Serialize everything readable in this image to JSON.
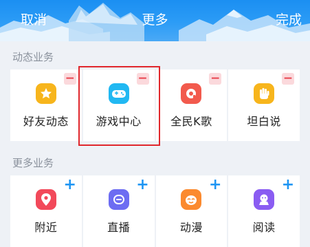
{
  "header": {
    "cancel_label": "取消",
    "title": "更多",
    "done_label": "完成"
  },
  "sections": [
    {
      "label": "动态业务",
      "items": [
        {
          "label": "好友动态",
          "icon": "star-icon",
          "color": "#f7b51c",
          "action": "−"
        },
        {
          "label": "游戏中心",
          "icon": "gamepad-icon",
          "color": "#21b8f2",
          "action": "−"
        },
        {
          "label": "全民K歌",
          "icon": "karaoke-icon",
          "color": "#f25a4d",
          "action": "−"
        },
        {
          "label": "坦白说",
          "icon": "hand-icon",
          "color": "#f7b51c",
          "action": "−"
        }
      ]
    },
    {
      "label": "更多业务",
      "items": [
        {
          "label": "附近",
          "icon": "location-pin-icon",
          "color": "#f2495a",
          "action": "+"
        },
        {
          "label": "直播",
          "icon": "live-icon",
          "color": "#6d6df2",
          "action": "+"
        },
        {
          "label": "动漫",
          "icon": "anime-icon",
          "color": "#fb8a2f",
          "action": "+"
        },
        {
          "label": "阅读",
          "icon": "reader-icon",
          "color": "#8a5cf2",
          "action": "+"
        }
      ]
    }
  ],
  "colors": {
    "header_blue": "#1b8ff2",
    "remove_red": "#e8414d",
    "add_blue": "#1d95f3",
    "highlight_red": "#e0262c"
  }
}
